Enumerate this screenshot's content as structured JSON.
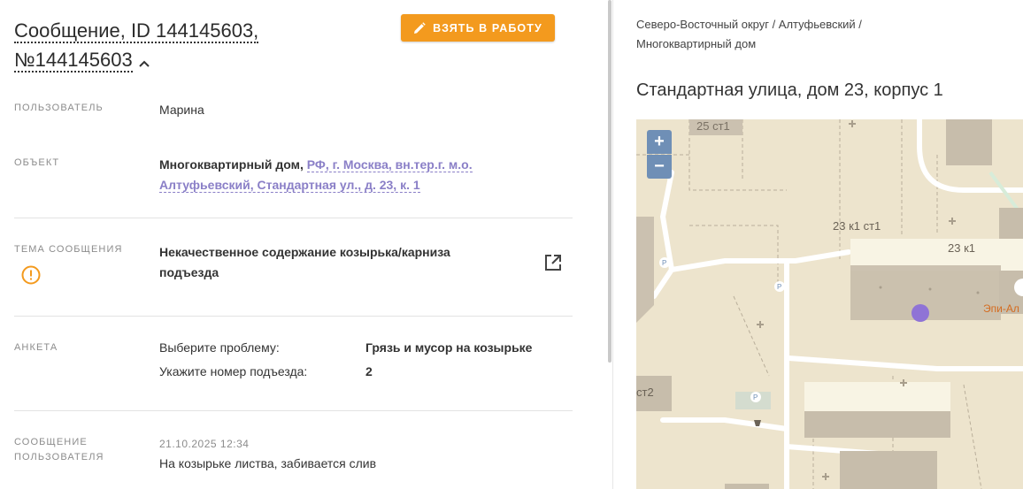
{
  "header": {
    "title_line1": "Сообщение, ID 144145603,",
    "title_line2": "№144145603",
    "take_button": "ВЗЯТЬ В РАБОТУ"
  },
  "fields": {
    "user_label": "ПОЛЬЗОВАТЕЛЬ",
    "user_value": "Марина",
    "object_label": "ОБЪЕКТ",
    "object_type": "Многоквартирный дом,",
    "object_link_line1": "РФ, г. Москва, вн.тер.г. м.о.",
    "object_link_line2": "Алтуфьевский, Стандартная ул., д. 23, к. 1",
    "topic_label": "ТЕМА СООБЩЕНИЯ",
    "topic_line1": "Некачественное содержание козырька/карниза",
    "topic_line2": "подъезда",
    "survey_label": "АНКЕТА",
    "survey": [
      {
        "q": "Выберите проблему:",
        "a": "Грязь и мусор на козырьке"
      },
      {
        "q": "Укажите номер подъезда:",
        "a": "2"
      }
    ],
    "message_label_line1": "СООБЩЕНИЕ",
    "message_label_line2": "ПОЛЬЗОВАТЕЛЯ",
    "message_date": "21.10.2025 12:34",
    "message_text": "На козырьке листва, забивается слив"
  },
  "location": {
    "breadcrumb_line1": "Северо-Восточный округ / Алтуфьевский /",
    "breadcrumb_line2": "Многоквартирный дом",
    "address": "Стандартная улица, дом 23, корпус 1"
  },
  "map": {
    "zoom_in": "+",
    "zoom_out": "−",
    "labels": {
      "b1": "25 ст1",
      "b2": "23 к1 ст1",
      "b3": "23 к1",
      "b4": "ст2",
      "poi": "Эпи-Ал",
      "p": "P"
    },
    "colors": {
      "marker": "#8f73d6",
      "accent": "#f39a1e",
      "link": "#8a7fc7",
      "zoom": "#6f8fb6"
    }
  }
}
